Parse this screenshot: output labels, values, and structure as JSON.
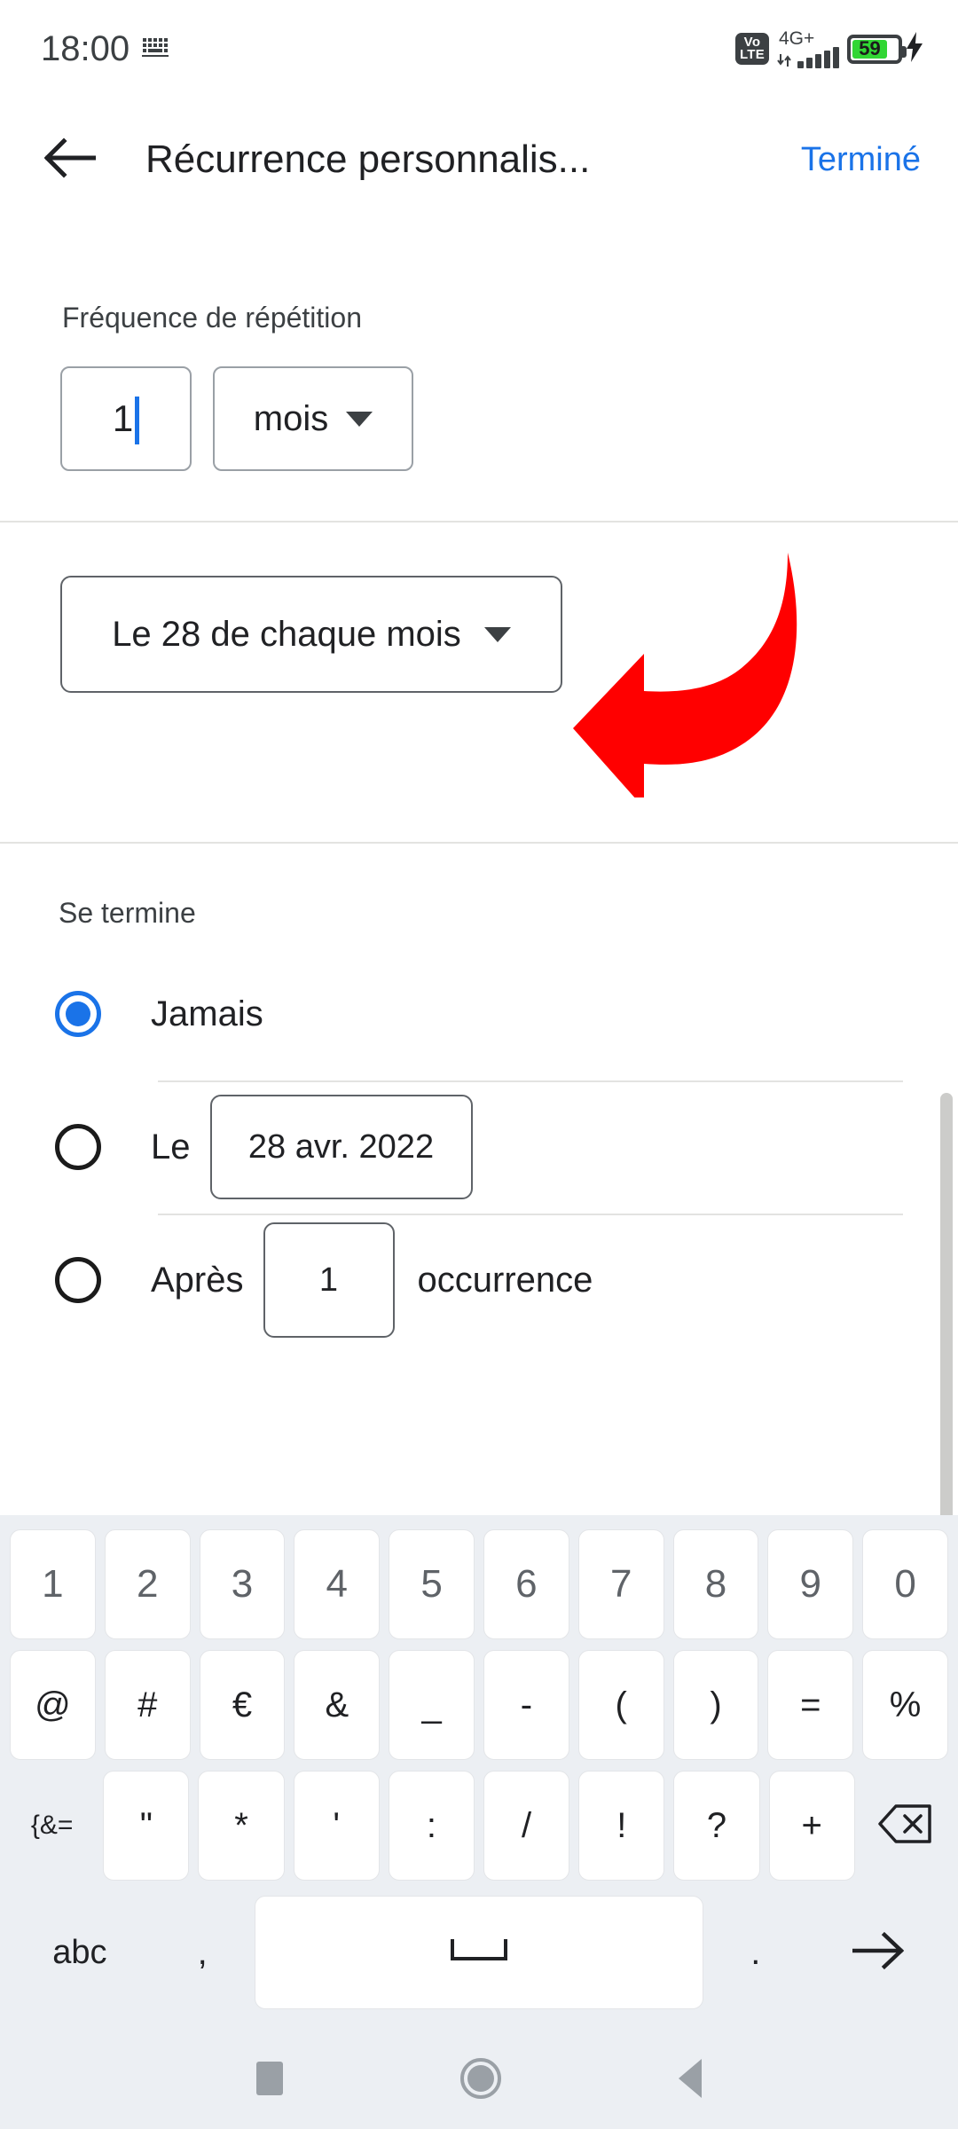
{
  "status_bar": {
    "time": "18:00",
    "keyboard_icon": "keyboard-icon",
    "volte_line1": "Vo",
    "volte_line2": "LTE",
    "network": "4G+",
    "battery_percent": "59",
    "charging_icon": "lightning-bolt-icon"
  },
  "app_bar": {
    "back_icon": "arrow-left-icon",
    "title": "Récurrence personnalis...",
    "done_label": "Terminé"
  },
  "frequency": {
    "label": "Fréquence de répétition",
    "interval_value": "1",
    "unit_value": "mois",
    "unit_dropdown_icon": "chevron-down-icon"
  },
  "monthly": {
    "pattern_value": "Le 28 de chaque mois",
    "pattern_dropdown_icon": "chevron-down-icon",
    "annotation_icon": "red-curved-arrow-left-icon",
    "annotation_color": "#FF0000"
  },
  "ends": {
    "label": "Se termine",
    "options": [
      {
        "id": "never",
        "label": "Jamais",
        "selected": true
      },
      {
        "id": "on_date",
        "label": "Le",
        "selected": false,
        "field_value": "28 avr. 2022"
      },
      {
        "id": "after_count",
        "label": "Après",
        "selected": false,
        "field_value": "1",
        "suffix": "occurrence"
      }
    ],
    "accent_color": "#1a73e8"
  },
  "scrollbar": {
    "name": "vertical-scrollbar"
  },
  "keyboard": {
    "rows": [
      {
        "type": "num",
        "keys": [
          "1",
          "2",
          "3",
          "4",
          "5",
          "6",
          "7",
          "8",
          "9",
          "0"
        ]
      },
      {
        "type": "sym",
        "keys": [
          "@",
          "#",
          "€",
          "&",
          "_",
          "-",
          "(",
          ")",
          "=",
          "%"
        ]
      },
      {
        "type": "sym3",
        "keys": [
          "{&=",
          "\"",
          "*",
          "'",
          ":",
          "/",
          "!",
          "?",
          "+",
          "⌫"
        ]
      },
      {
        "type": "bottom",
        "keys": [
          "abc",
          ",",
          "␣",
          ".",
          "→"
        ]
      }
    ],
    "shift_symbol_label": "{&=",
    "backspace_icon": "backspace-icon",
    "abc_label": "abc",
    "comma_label": ",",
    "space_icon": "space-bar-icon",
    "period_label": ".",
    "enter_icon": "arrow-right-icon"
  },
  "nav_bar": {
    "recents_icon": "square-recents-icon",
    "home_icon": "circle-home-icon",
    "back_icon": "triangle-back-icon"
  }
}
